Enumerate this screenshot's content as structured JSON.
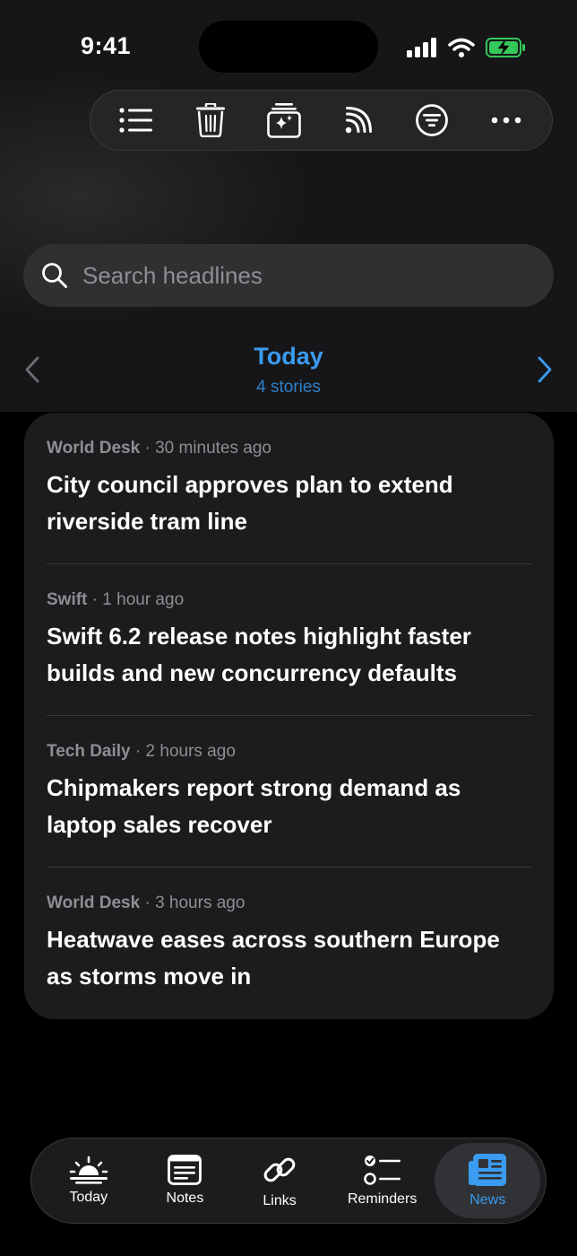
{
  "status": {
    "time": "9:41"
  },
  "toolbar": {
    "icons": [
      "list-icon",
      "trash-icon",
      "sparkle-card-icon",
      "rss-icon",
      "filter-icon",
      "more-icon"
    ]
  },
  "search": {
    "placeholder": "Search headlines"
  },
  "date_nav": {
    "title": "Today",
    "subtitle": "4 stories"
  },
  "stories": [
    {
      "source": "World Desk",
      "time": "30 minutes ago",
      "headline": "City council approves plan to extend riverside tram line"
    },
    {
      "source": "Swift",
      "time": "1 hour ago",
      "headline": "Swift 6.2 release notes highlight faster builds and new concurrency defaults"
    },
    {
      "source": "Tech Daily",
      "time": "2 hours ago",
      "headline": "Chipmakers report strong demand as laptop sales recover"
    },
    {
      "source": "World Desk",
      "time": "3 hours ago",
      "headline": "Heatwave eases across southern Europe as storms move in"
    }
  ],
  "tabs": [
    {
      "label": "Today",
      "icon": "sunrise-icon"
    },
    {
      "label": "Notes",
      "icon": "note-icon"
    },
    {
      "label": "Links",
      "icon": "link-icon"
    },
    {
      "label": "Reminders",
      "icon": "checklist-icon"
    },
    {
      "label": "News",
      "icon": "newspaper-icon",
      "active": true
    }
  ],
  "colors": {
    "accent": "#3a9bf0",
    "battery": "#34c759"
  }
}
